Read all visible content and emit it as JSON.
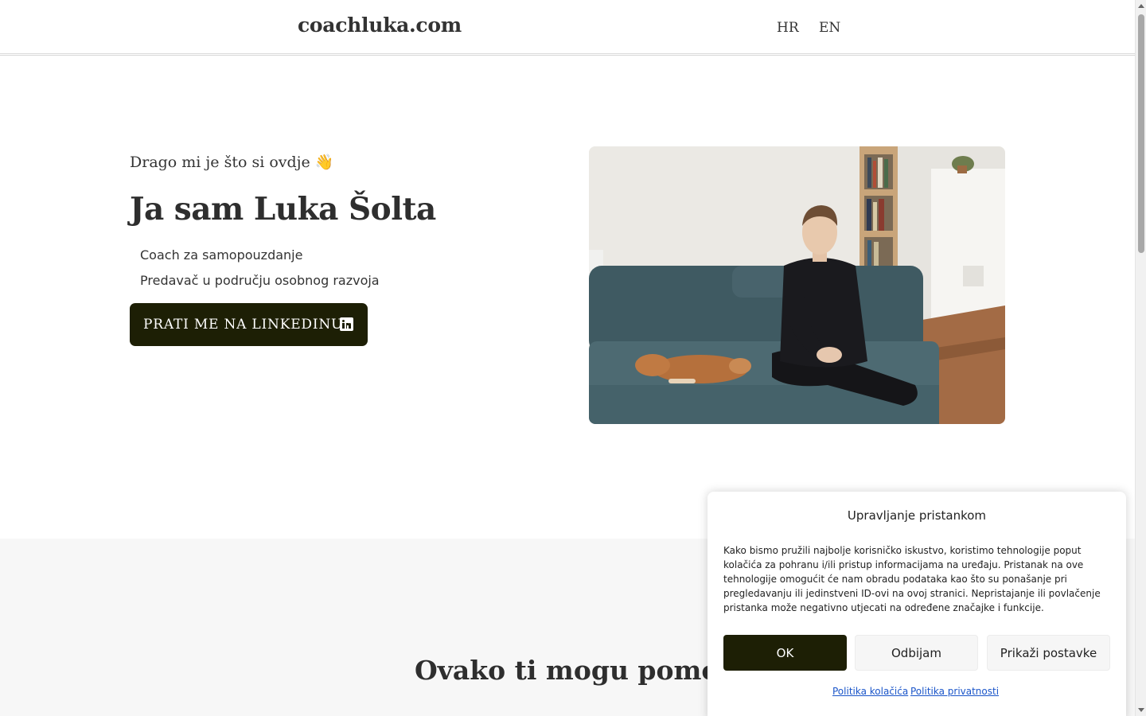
{
  "header": {
    "logo": "coachluka.com",
    "languages": [
      "HR",
      "EN"
    ]
  },
  "hero": {
    "greeting": "Drago mi je što si ovdje 👋",
    "title": "Ja sam Luka Šolta",
    "roles": [
      "Coach za samopouzdanje",
      "Predavač u području osobnog razvoja"
    ],
    "cta_label": "PRATI ME NA LINKEDINU",
    "photo": "photo of a man sitting on a grey sofa next to a sleeping brown dog"
  },
  "services": {
    "title": "Ovako ti mogu pomoći"
  },
  "consent": {
    "title": "Upravljanje pristankom",
    "text": "Kako bismo pružili najbolje korisničko iskustvo, koristimo tehnologije poput kolačića za pohranu i/ili pristup informacijama na uređaju. Pristanak na ove tehnologije omogućit će nam obradu podataka kao što su ponašanje pri pregledavanju ili jedinstveni ID-ovi na ovoj stranici. Nepristajanje ili povlačenje pristanka može negativno utjecati na određene značajke i funkcije.",
    "ok_label": "OK",
    "deny_label": "Odbijam",
    "prefs_label": "Prikaži postavke",
    "links": [
      "Politika kolačića",
      "Politika privatnosti"
    ]
  },
  "colors": {
    "accent": "#1d1f05",
    "band": "#f7f7f7",
    "link": "#1a55c9"
  }
}
